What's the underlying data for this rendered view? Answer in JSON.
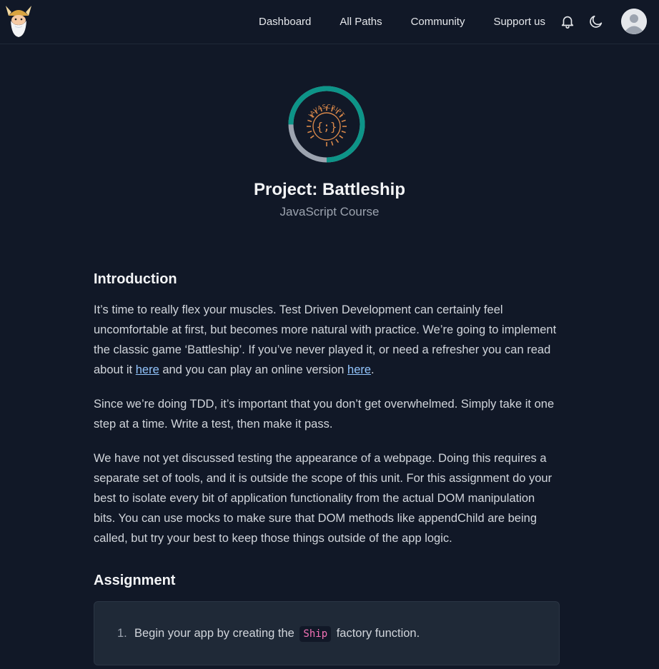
{
  "nav": {
    "links": [
      "Dashboard",
      "All Paths",
      "Community",
      "Support us"
    ],
    "bell_icon": "bell-icon",
    "theme_icon": "moon-icon",
    "avatar_icon": "user-avatar"
  },
  "badge": {
    "label": "JAVASCRIPT",
    "glyph": "{;}",
    "progress": 0.75,
    "progress_color": "#0d9488",
    "track_color": "#9ca3af"
  },
  "header": {
    "title": "Project: Battleship",
    "subtitle": "JavaScript Course"
  },
  "introduction": {
    "heading": "Introduction",
    "p1_before": "It’s time to really flex your muscles. Test Driven Development can certainly feel uncomfortable at first, but becomes more natural with practice. We’re going to implement the classic game ‘Battleship’. If you’ve never played it, or need a refresher you can read about it ",
    "p1_link1": "here",
    "p1_middle": " and you can play an online version ",
    "p1_link2": "here",
    "p1_after": ".",
    "p2": "Since we’re doing TDD, it’s important that you don’t get overwhelmed. Simply take it one step at a time. Write a test, then make it pass.",
    "p3": "We have not yet discussed testing the appearance of a webpage. Doing this requires a separate set of tools, and it is outside the scope of this unit. For this assignment do your best to isolate every bit of application functionality from the actual DOM manipulation bits. You can use mocks to make sure that DOM methods like appendChild are being called, but try your best to keep those things outside of the app logic."
  },
  "assignment": {
    "heading": "Assignment",
    "items": [
      {
        "number": "1.",
        "before": "Begin your app by creating the ",
        "code": "Ship",
        "after": " factory function."
      }
    ]
  }
}
